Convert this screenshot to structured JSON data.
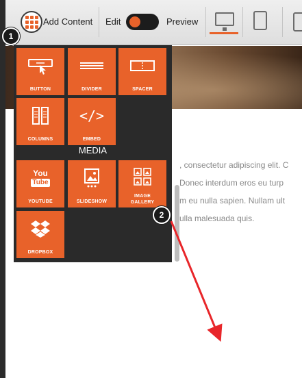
{
  "toolbar": {
    "add_content_label": "Add Content",
    "edit_label": "Edit",
    "preview_label": "Preview"
  },
  "panel": {
    "tiles": [
      {
        "label": "BUTTON",
        "icon": "button-icon"
      },
      {
        "label": "DIVIDER",
        "icon": "divider-icon"
      },
      {
        "label": "SPACER",
        "icon": "spacer-icon"
      },
      {
        "label": "COLUMNS",
        "icon": "columns-icon"
      },
      {
        "label": "EMBED",
        "icon": "embed-icon"
      }
    ],
    "media_heading": "MEDIA",
    "media_tiles": [
      {
        "label": "YOUTUBE",
        "icon": "youtube-icon"
      },
      {
        "label": "SLIDESHOW",
        "icon": "slideshow-icon"
      },
      {
        "label": "IMAGE GALLERY",
        "icon": "image-gallery-icon"
      },
      {
        "label": "DROPBOX",
        "icon": "dropbox-icon"
      }
    ],
    "embed_glyph": "</>",
    "youtube_glyph_top": "You",
    "youtube_glyph_bottom": "Tube",
    "image_gallery_line1": "IMAGE",
    "image_gallery_line2": "GALLERY"
  },
  "content": {
    "lines": [
      ", consectetur adipiscing elit. C",
      "Donec interdum eros eu turp",
      "m eu nulla sapien. Nullam ult",
      "ulla malesuada quis."
    ]
  },
  "callouts": [
    "1",
    "2"
  ],
  "colors": {
    "accent": "#e8622a",
    "panel_bg": "#2a2a2a",
    "arrow": "#e8262a"
  }
}
